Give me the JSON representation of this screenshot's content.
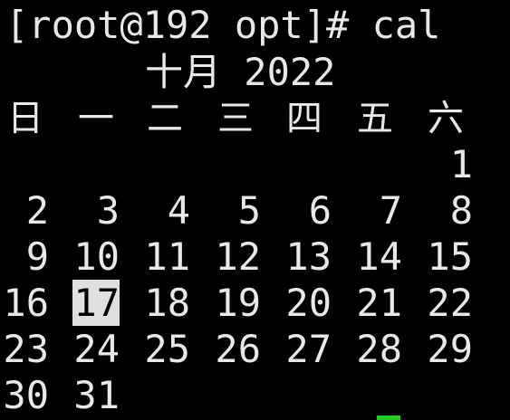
{
  "terminal": {
    "prompt": "[root@192 opt]# ",
    "command": "cal",
    "colors": {
      "background": "#000000",
      "text": "#e8e8e8",
      "highlight_bg": "#e0e0e0",
      "highlight_fg": "#000000",
      "cursor": "#22cc22"
    }
  },
  "calendar": {
    "month_year": "十月 2022",
    "weekdays": [
      "日",
      "一",
      "二",
      "三",
      "四",
      "五",
      "六"
    ],
    "weeks": [
      [
        "",
        "",
        "",
        "",
        "",
        "",
        "1"
      ],
      [
        "2",
        "3",
        "4",
        "5",
        "6",
        "7",
        "8"
      ],
      [
        "9",
        "10",
        "11",
        "12",
        "13",
        "14",
        "15"
      ],
      [
        "16",
        "17",
        "18",
        "19",
        "20",
        "21",
        "22"
      ],
      [
        "23",
        "24",
        "25",
        "26",
        "27",
        "28",
        "29"
      ],
      [
        "30",
        "31",
        "",
        "",
        "",
        "",
        ""
      ]
    ],
    "today": "17"
  }
}
